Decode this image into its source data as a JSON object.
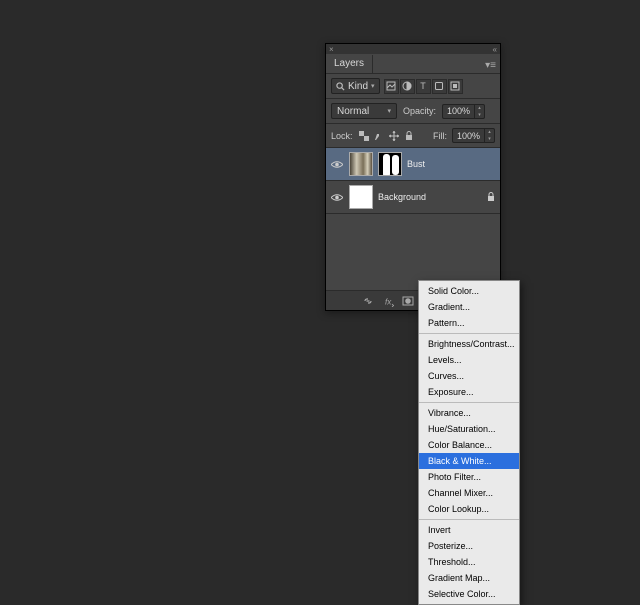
{
  "panel": {
    "title": "Layers",
    "filter": {
      "kind_label": "Kind"
    },
    "blend": {
      "mode": "Normal",
      "opacity_label": "Opacity:",
      "opacity_value": "100%"
    },
    "lock": {
      "label": "Lock:",
      "fill_label": "Fill:",
      "fill_value": "100%"
    },
    "layers": [
      {
        "name": "Bust",
        "selected": true,
        "has_mask": true,
        "locked": false
      },
      {
        "name": "Background",
        "selected": false,
        "has_mask": false,
        "locked": true
      }
    ]
  },
  "menu": {
    "groups": [
      [
        "Solid Color...",
        "Gradient...",
        "Pattern..."
      ],
      [
        "Brightness/Contrast...",
        "Levels...",
        "Curves...",
        "Exposure..."
      ],
      [
        "Vibrance...",
        "Hue/Saturation...",
        "Color Balance...",
        "Black & White...",
        "Photo Filter...",
        "Channel Mixer...",
        "Color Lookup..."
      ],
      [
        "Invert",
        "Posterize...",
        "Threshold...",
        "Gradient Map...",
        "Selective Color..."
      ]
    ],
    "highlighted": "Black & White..."
  }
}
